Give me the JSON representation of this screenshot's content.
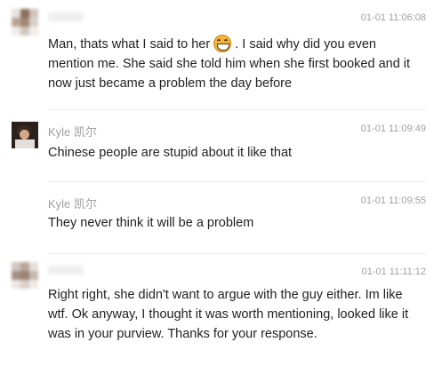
{
  "messages": [
    {
      "time": "01-01 11:06:08",
      "text_before_emoji": "Man, thats what I said to her ",
      "emoji": "grinning-face-emoji",
      "text_after_emoji": " . I said why did you even mention me. She said she told him when she first booked and it now just became a problem the day before"
    },
    {
      "sender": "Kyle 凯尔",
      "time": "01-01 11:09:49",
      "text": "Chinese people are stupid about it like that"
    },
    {
      "sender": "Kyle 凯尔",
      "time": "01-01 11:09:55",
      "text": "They never think it will be a problem"
    },
    {
      "time": "01-01 11:11:12",
      "text": "Right right, she didn't want to argue with the guy either. Im like wtf. Ok anyway, I thought it was worth mentioning, looked like it was in your purview. Thanks for your response."
    }
  ],
  "colors": {
    "meta_text": "#a0a0a0",
    "body_text": "#1f1f1f",
    "separator": "#ececec"
  }
}
